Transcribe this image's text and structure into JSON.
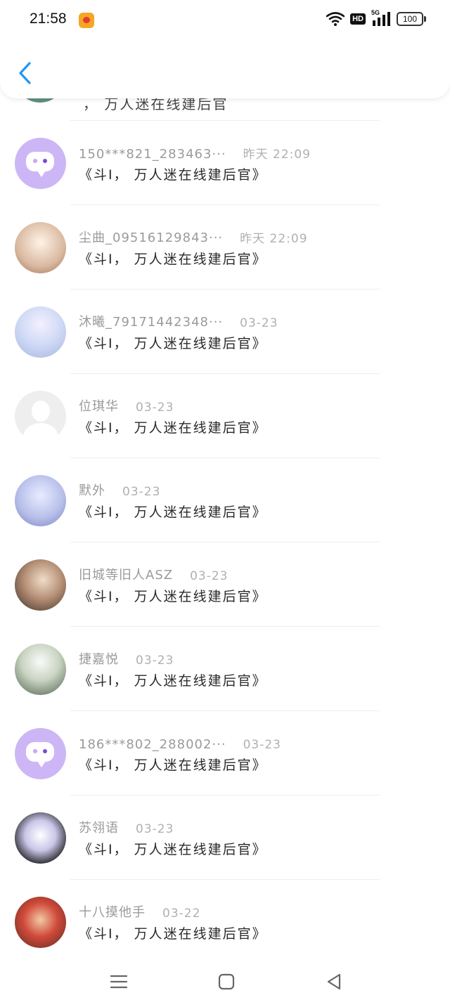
{
  "status_bar": {
    "time": "21:58",
    "network": "5G",
    "hd": "HD",
    "battery": "100"
  },
  "previous_row_fragment": "，  万人迷在线建后官",
  "list": [
    {
      "name": "150***821_283463···",
      "time": "昨天 22:09",
      "message": "《斗I， 万人迷在线建后官》",
      "avatar": "message-bubble"
    },
    {
      "name": "尘曲_09516129843···",
      "time": "昨天 22:09",
      "message": "《斗I， 万人迷在线建后官》",
      "avatar": "photo"
    },
    {
      "name": "沐曦_79171442348···",
      "time": "03-23",
      "message": "《斗I， 万人迷在线建后官》",
      "avatar": "photo"
    },
    {
      "name": "位琪华",
      "time": "03-23",
      "message": "《斗I， 万人迷在线建后官》",
      "avatar": "blank"
    },
    {
      "name": "默外",
      "time": "03-23",
      "message": "《斗I， 万人迷在线建后官》",
      "avatar": "photo"
    },
    {
      "name": "旧城等旧人ASZ",
      "time": "03-23",
      "message": "《斗I， 万人迷在线建后官》",
      "avatar": "photo"
    },
    {
      "name": "捷嘉悦",
      "time": "03-23",
      "message": "《斗I， 万人迷在线建后官》",
      "avatar": "photo"
    },
    {
      "name": "186***802_288002···",
      "time": "03-23",
      "message": "《斗I， 万人迷在线建后官》",
      "avatar": "message-bubble"
    },
    {
      "name": "苏翎语",
      "time": "03-23",
      "message": "《斗I， 万人迷在线建后官》",
      "avatar": "photo"
    },
    {
      "name": "十八摸他手",
      "time": "03-22",
      "message": "《斗I， 万人迷在线建后官》",
      "avatar": "photo"
    }
  ],
  "icons": {
    "back": "chevron-left-icon",
    "nav_menu": "menu-icon",
    "nav_home": "square-icon",
    "nav_back": "triangle-back-icon"
  },
  "colors": {
    "accent": "#2196f3",
    "avatar_purple": "#cdb6f5"
  }
}
